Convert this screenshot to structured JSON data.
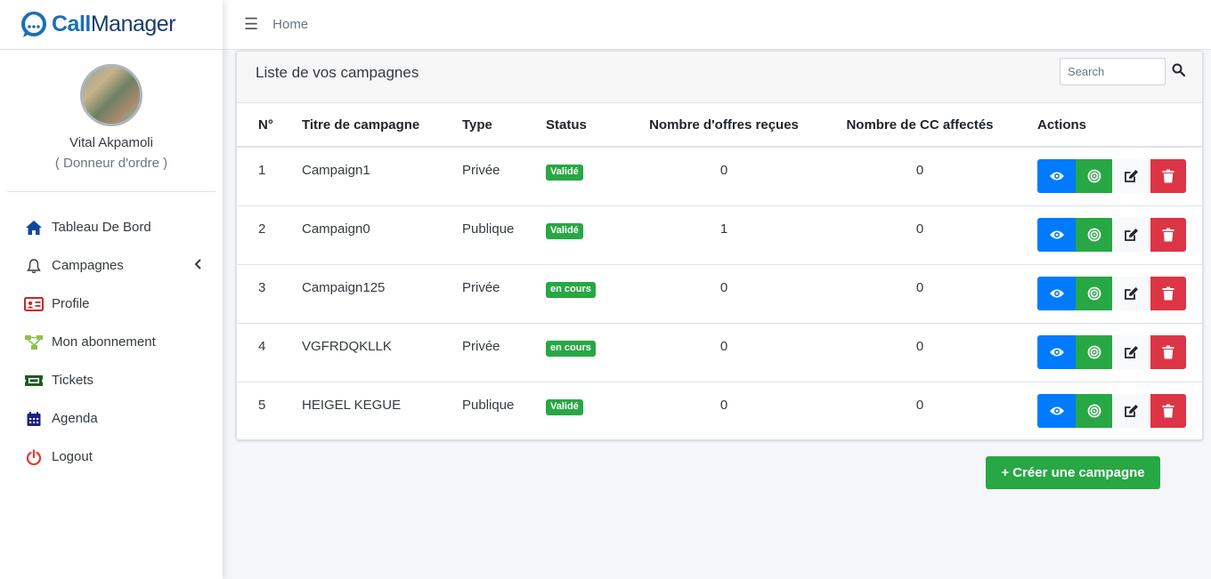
{
  "brand": {
    "part1": "Call",
    "part2": "Manager"
  },
  "user": {
    "name": "Vital Akpamoli",
    "role": "( Donneur d'ordre )"
  },
  "nav": [
    {
      "label": "Tableau De Bord",
      "icon": "home-icon",
      "color": "#0d47a1"
    },
    {
      "label": "Campagnes",
      "icon": "bell-icon",
      "color": "#343a40"
    },
    {
      "label": "Profile",
      "icon": "id-card-icon",
      "color": "#c62828"
    },
    {
      "label": "Mon abonnement",
      "icon": "sitemap-icon",
      "color": "#8bc34a"
    },
    {
      "label": "Tickets",
      "icon": "ticket-icon",
      "color": "#1b5e20"
    },
    {
      "label": "Agenda",
      "icon": "calendar-icon",
      "color": "#1a237e"
    },
    {
      "label": "Logout",
      "icon": "power-icon",
      "color": "#e53935"
    }
  ],
  "nav_caret": "‹",
  "topbar": {
    "menu_icon": "☰",
    "home": "Home"
  },
  "card": {
    "title": "Liste de vos campagnes",
    "search_placeholder": "Search"
  },
  "table": {
    "headers": [
      "N°",
      "Titre de campagne",
      "Type",
      "Status",
      "Nombre d'offres reçues",
      "Nombre de CC affectés",
      "Actions"
    ],
    "rows": [
      {
        "n": "1",
        "title": "Campaign1",
        "type": "Privée",
        "status": "Validé",
        "offers": "0",
        "cc": "0"
      },
      {
        "n": "2",
        "title": "Campaign0",
        "type": "Publique",
        "status": "Validé",
        "offers": "1",
        "cc": "0"
      },
      {
        "n": "3",
        "title": "Campaign125",
        "type": "Privée",
        "status": "en cours",
        "offers": "0",
        "cc": "0"
      },
      {
        "n": "4",
        "title": "VGFRDQKLLK",
        "type": "Privée",
        "status": "en cours",
        "offers": "0",
        "cc": "0"
      },
      {
        "n": "5",
        "title": "HEIGEL KEGUE",
        "type": "Publique",
        "status": "Validé",
        "offers": "0",
        "cc": "0"
      }
    ]
  },
  "create_button": "+ Créer une campagne",
  "colors": {
    "primary": "#007bff",
    "success": "#28a745",
    "danger": "#dc3545"
  }
}
